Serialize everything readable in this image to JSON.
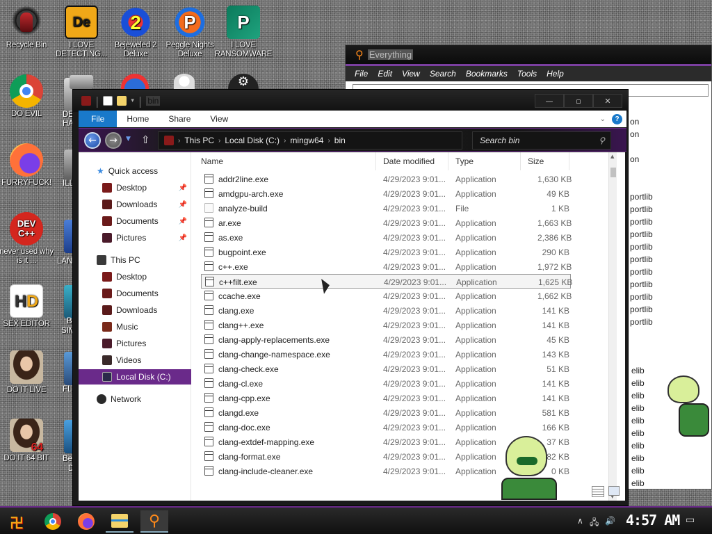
{
  "desktop": {
    "icons": [
      {
        "label": "Recycle Bin",
        "icon": "recycle-bin-icon"
      },
      {
        "label": "I LOVE DETECTING...",
        "icon": "de-app-icon"
      },
      {
        "label": "Bejeweled 2 Deluxe",
        "icon": "bejeweled-icon"
      },
      {
        "label": "Peggle Nights Deluxe",
        "icon": "peggle-icon"
      },
      {
        "label": "I LOVE RANSOMWARE",
        "icon": "publisher-icon"
      },
      {
        "label": "DO EVIL",
        "icon": "chrome-icon"
      },
      {
        "label": "FURRYFUCK!",
        "icon": "firefox-icon"
      },
      {
        "label": "never used why is it ...",
        "icon": "devcpp-icon"
      },
      {
        "label": "SEX EDITOR",
        "icon": "hxd-icon"
      },
      {
        "label": "DO IT LIVE",
        "icon": "portrait-icon"
      },
      {
        "label": "DO IT 64 BIT",
        "icon": "portrait-64-icon"
      }
    ],
    "partial_labels": [
      "DE",
      "HA",
      "ILL",
      "LANG",
      "B",
      "SIM",
      "FL",
      "Be",
      "D"
    ]
  },
  "everything": {
    "title": "Everything",
    "menu": [
      "File",
      "Edit",
      "View",
      "Search",
      "Bookmarks",
      "Tools",
      "Help"
    ],
    "visible_right_column": [
      "on",
      "on",
      "on",
      "portlib",
      "portlib",
      "portlib",
      "portlib",
      "portlib",
      "portlib",
      "portlib",
      "portlib",
      "portlib",
      "portlib",
      "portlib",
      "elib",
      "elib",
      "elib",
      "elib",
      "elib",
      "elib",
      "elib",
      "elib",
      "elib",
      "elib"
    ]
  },
  "explorer": {
    "title": "bin",
    "ribbon_tabs": [
      "File",
      "Home",
      "Share",
      "View"
    ],
    "address": [
      "This PC",
      "Local Disk (C:)",
      "mingw64",
      "bin"
    ],
    "search_placeholder": "Search bin",
    "nav": {
      "quick_access": "Quick access",
      "quick_items": [
        "Desktop",
        "Downloads",
        "Documents",
        "Pictures"
      ],
      "this_pc": "This PC",
      "pc_items": [
        "Desktop",
        "Documents",
        "Downloads",
        "Music",
        "Pictures",
        "Videos",
        "Local Disk (C:)"
      ],
      "network": "Network"
    },
    "columns": [
      "Name",
      "Date modified",
      "Type",
      "Size"
    ],
    "files": [
      {
        "name": "addr2line.exe",
        "date": "4/29/2023 9:01...",
        "type": "Application",
        "size": "1,630 KB"
      },
      {
        "name": "amdgpu-arch.exe",
        "date": "4/29/2023 9:01...",
        "type": "Application",
        "size": "49 KB"
      },
      {
        "name": "analyze-build",
        "date": "4/29/2023 9:01...",
        "type": "File",
        "size": "1 KB"
      },
      {
        "name": "ar.exe",
        "date": "4/29/2023 9:01...",
        "type": "Application",
        "size": "1,663 KB"
      },
      {
        "name": "as.exe",
        "date": "4/29/2023 9:01...",
        "type": "Application",
        "size": "2,386 KB"
      },
      {
        "name": "bugpoint.exe",
        "date": "4/29/2023 9:01...",
        "type": "Application",
        "size": "290 KB"
      },
      {
        "name": "c++.exe",
        "date": "4/29/2023 9:01...",
        "type": "Application",
        "size": "1,972 KB"
      },
      {
        "name": "c++filt.exe",
        "date": "4/29/2023 9:01...",
        "type": "Application",
        "size": "1,625 KB"
      },
      {
        "name": "ccache.exe",
        "date": "4/29/2023 9:01...",
        "type": "Application",
        "size": "1,662 KB"
      },
      {
        "name": "clang.exe",
        "date": "4/29/2023 9:01...",
        "type": "Application",
        "size": "141 KB"
      },
      {
        "name": "clang++.exe",
        "date": "4/29/2023 9:01...",
        "type": "Application",
        "size": "141 KB"
      },
      {
        "name": "clang-apply-replacements.exe",
        "date": "4/29/2023 9:01...",
        "type": "Application",
        "size": "45 KB"
      },
      {
        "name": "clang-change-namespace.exe",
        "date": "4/29/2023 9:01...",
        "type": "Application",
        "size": "143 KB"
      },
      {
        "name": "clang-check.exe",
        "date": "4/29/2023 9:01...",
        "type": "Application",
        "size": "51 KB"
      },
      {
        "name": "clang-cl.exe",
        "date": "4/29/2023 9:01...",
        "type": "Application",
        "size": "141 KB"
      },
      {
        "name": "clang-cpp.exe",
        "date": "4/29/2023 9:01...",
        "type": "Application",
        "size": "141 KB"
      },
      {
        "name": "clangd.exe",
        "date": "4/29/2023 9:01...",
        "type": "Application",
        "size": "581 KB"
      },
      {
        "name": "clang-doc.exe",
        "date": "4/29/2023 9:01...",
        "type": "Application",
        "size": "166 KB"
      },
      {
        "name": "clang-extdef-mapping.exe",
        "date": "4/29/2023 9:01...",
        "type": "Application",
        "size": "37 KB"
      },
      {
        "name": "clang-format.exe",
        "date": "4/29/2023 9:01...",
        "type": "Application",
        "size": "82 KB"
      },
      {
        "name": "clang-include-cleaner.exe",
        "date": "4/29/2023 9:01...",
        "type": "Application",
        "size": "0 KB"
      }
    ],
    "selected_file": "c++filt.exe"
  },
  "taskbar": {
    "apps": [
      "start-icon",
      "chrome-icon",
      "firefox-icon",
      "file-explorer-icon",
      "everything-icon"
    ],
    "clock": "4:57 AM"
  },
  "colors": {
    "accent": "#6a2a8a",
    "ribbon_file": "#1979ca",
    "frame": "#1a1a1a"
  }
}
